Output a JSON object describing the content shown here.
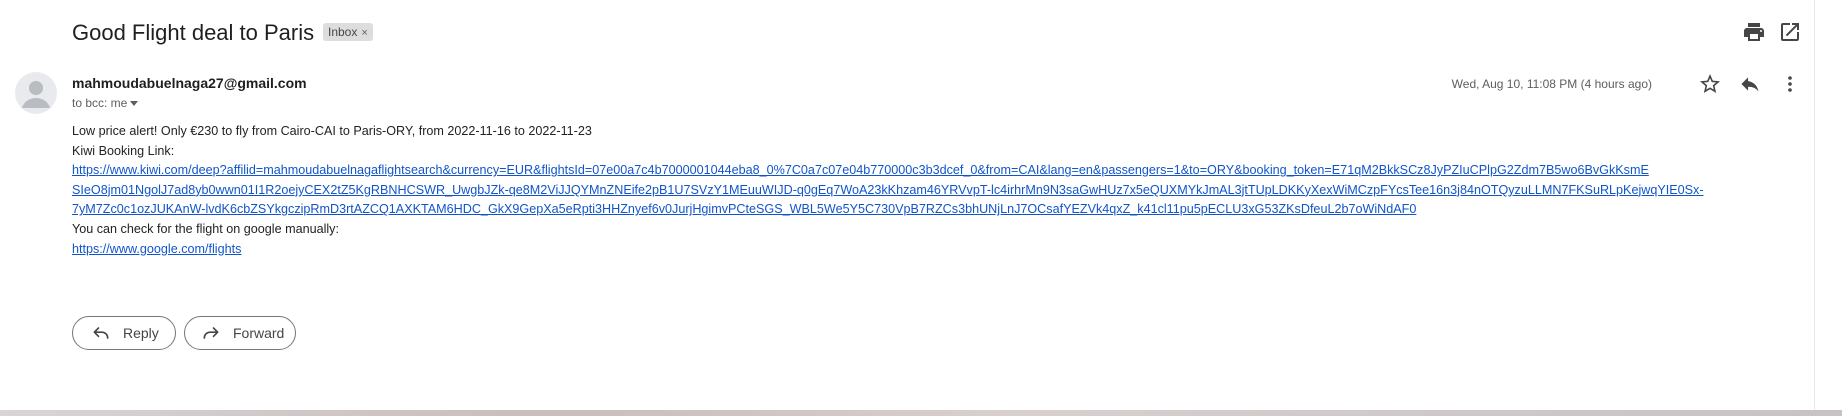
{
  "email": {
    "subject": "Good Flight deal to Paris",
    "label_chip": "Inbox",
    "label_chip_close": "×",
    "sender": "mahmoudabuelnaga27@gmail.com",
    "recipient": "to bcc: me",
    "date": "Wed, Aug 10, 11:08 PM (4 hours ago)"
  },
  "body": {
    "line1": "Low price alert! Only €230 to fly from Cairo-CAI to Paris-ORY, from 2022-11-16 to 2022-11-23",
    "line2": "Kiwi Booking Link:",
    "kiwi_link_1": "https://www.kiwi.com/deep?affilid=mahmoudabuelnagaflightsearch&currency=EUR&flightsId=07e00a7c4b7000001044eba8_0%7C0a7c07e04b770000c3b3dcef_0&from=CAI&lang=en&passengers=1&to=ORY&booking_token=E71qM2BkkSCz8JyPZIuCPlpG2Zdm7B5wo6BvGkKsmE",
    "kiwi_link_2": "SIeO8jm01NgolJ7ad8yb0wwn01I1R2oejyCEX2tZ5KgRBNHCSWR_UwgbJZk-qe8M2ViJJQYMnZNEife2pB1U7SVzY1MEuuWIJD-q0gEq7WoA23kKhzam46YRVvpT-lc4irhrMn9N3saGwHUz7x5eQUXMYkJmAL3jtTUpLDKKyXexWiMCzpFYcsTee16n3j84nOTQyzuLLMN7FKSuRLpKejwqYIE0Sx-",
    "kiwi_link_3": "7yM7Zc0c1ozJUKAnW-lvdK6cbZSYkgczipRmD3rtAZCQ1AXKTAM6HDC_GkX9GepXa5eRpti3HHZnyef6v0JurjHgimvPCteSGS_WBL5We5Y5C730VpB7RZCs3bhUNjLnJ7OCsafYEZVk4qxZ_k41cl11pu5pECLU3xG53ZKsDfeuL2b7oWiNdAF0",
    "line4": "You can check for the flight on google manually:",
    "google_link": "https://www.google.com/flights"
  },
  "actions": {
    "reply_label": "Reply",
    "forward_label": "Forward"
  },
  "icons": {
    "print": "print-icon",
    "open_new_window": "open-in-new-window-icon",
    "star": "star-icon",
    "reply": "reply-icon",
    "more": "more-vert-icon"
  },
  "colors": {
    "link": "#1155cc",
    "chip_bg": "#dddddd"
  }
}
